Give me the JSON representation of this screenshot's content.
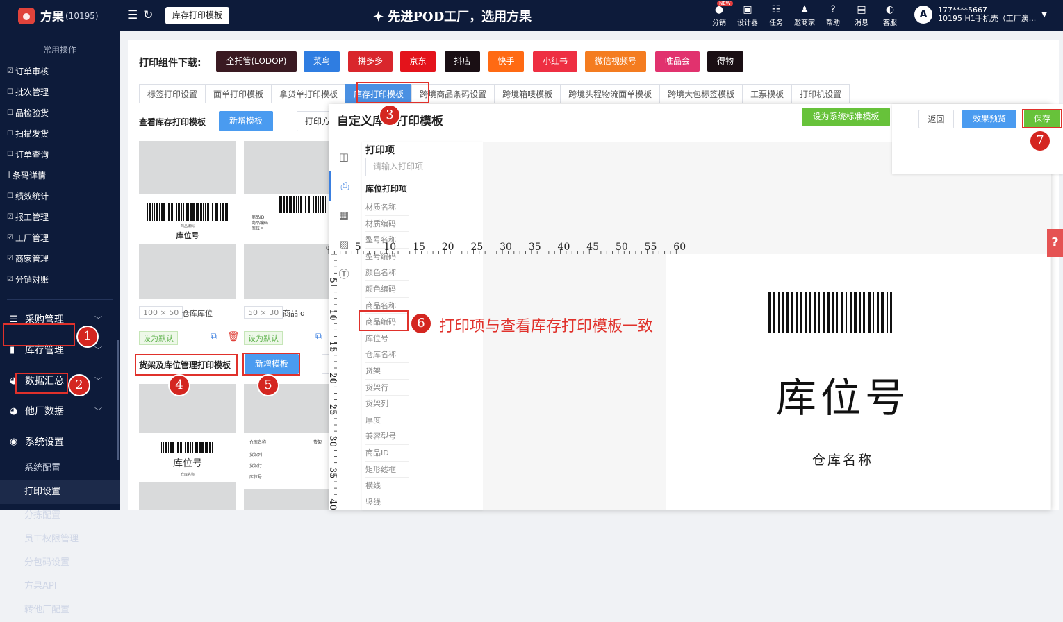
{
  "brand": {
    "name": "方果",
    "id": "(10195)"
  },
  "topbar": {
    "tab_label": "库存打印模板",
    "slogan": "先进POD工厂，选用方果",
    "new_badge": "NEW",
    "nav": [
      {
        "label": "分销",
        "icon": "distribution-icon"
      },
      {
        "label": "设计器",
        "icon": "designer-icon"
      },
      {
        "label": "任务",
        "icon": "task-icon"
      },
      {
        "label": "邀商家",
        "icon": "invite-icon"
      },
      {
        "label": "帮助",
        "icon": "help-icon"
      },
      {
        "label": "消息",
        "icon": "message-icon"
      },
      {
        "label": "客服",
        "icon": "service-icon"
      }
    ],
    "user_phone": "177****5667",
    "user_account": "10195 H1手机壳（工厂演..."
  },
  "sidebar": {
    "common_title": "常用操作",
    "quick": [
      "订单审核",
      "批次管理",
      "品检验货",
      "扫描发货",
      "订单查询",
      "条码详情",
      "绩效统计",
      "报工管理",
      "工厂管理",
      "商家管理",
      "分销对账"
    ],
    "groups": [
      "采购管理",
      "库存管理",
      "数据汇总",
      "他厂数据",
      "系统设置"
    ],
    "sub": [
      "系统配置",
      "打印设置",
      "分拣配置",
      "员工权限管理",
      "分包码设置",
      "方果API",
      "转他厂配置"
    ]
  },
  "download": {
    "label": "打印组件下载:",
    "buttons": [
      {
        "label": "全托管(LODOP)",
        "color": "#3a1a22"
      },
      {
        "label": "菜鸟",
        "color": "#2f7de1"
      },
      {
        "label": "拼多多",
        "color": "#d9262c"
      },
      {
        "label": "京东",
        "color": "#e4131b"
      },
      {
        "label": "抖店",
        "color": "#1a0f14"
      },
      {
        "label": "快手",
        "color": "#ff6a13"
      },
      {
        "label": "小红书",
        "color": "#ee2f42"
      },
      {
        "label": "微信视频号",
        "color": "#f47c20"
      },
      {
        "label": "唯品会",
        "color": "#e1326e"
      },
      {
        "label": "得物",
        "color": "#1a0f14"
      }
    ]
  },
  "tabs": [
    "标签打印设置",
    "面单打印模板",
    "拿货单打印模板",
    "库存打印模板",
    "跨境商品条码设置",
    "跨境箱唛模板",
    "跨境头程物流面单模板",
    "跨境大包标签模板",
    "工票模板",
    "打印机设置"
  ],
  "section1": {
    "title": "查看库存打印模板",
    "new_btn": "新增模板",
    "print_btn": "打印方",
    "cards": [
      {
        "size": "100 × 50",
        "name": "仓库库位",
        "barcode_small": "商品编码",
        "big": "库位号"
      },
      {
        "size": "50 × 30",
        "name": "商品id",
        "lines": [
          "商品ID",
          "商品编码",
          "库位号"
        ]
      }
    ],
    "default_btn": "设为默认"
  },
  "section2": {
    "title": "货架及库位管理打印模板",
    "new_btn": "新增模板",
    "card1": {
      "big": "库位号",
      "small": "仓库名称"
    },
    "card2": {
      "col1": "仓库名称",
      "col2": "货架",
      "lines": [
        "货架列",
        "货架行",
        "库位号"
      ]
    }
  },
  "dialog": {
    "title": "自定义库存打印模板",
    "set_standard": "设为系统标准模板",
    "items_title": "打印项",
    "search_placeholder": "请输入打印项",
    "group_title": "库位打印项",
    "items": [
      "材质名称",
      "材质编码",
      "型号名称",
      "型号编码",
      "颜色名称",
      "颜色编码",
      "商品名称",
      "商品编码",
      "库位号",
      "仓库名称",
      "货架",
      "货架行",
      "货架列",
      "厚度",
      "兼容型号",
      "商品ID",
      "矩形线框",
      "横线",
      "竖线"
    ],
    "side_icons": [
      "template-list-icon",
      "printer-icon",
      "qrcode-icon",
      "image-icon",
      "text-icon"
    ]
  },
  "ruler": {
    "top": [
      "0",
      "5",
      "10",
      "15",
      "20",
      "25",
      "30",
      "35",
      "40",
      "45",
      "50",
      "55",
      "60"
    ],
    "left": [
      "5",
      "10",
      "15",
      "20",
      "25",
      "30",
      "35",
      "40"
    ]
  },
  "label_preview": {
    "big": "库位号",
    "small": "仓库名称"
  },
  "right_panel": {
    "back": "返回",
    "preview": "效果预览",
    "save": "保存"
  },
  "annotation": {
    "text": "打印项与查看库存打印模板一致",
    "badges": [
      "1",
      "2",
      "3",
      "4",
      "5",
      "6",
      "7"
    ]
  },
  "side_tab": "?"
}
